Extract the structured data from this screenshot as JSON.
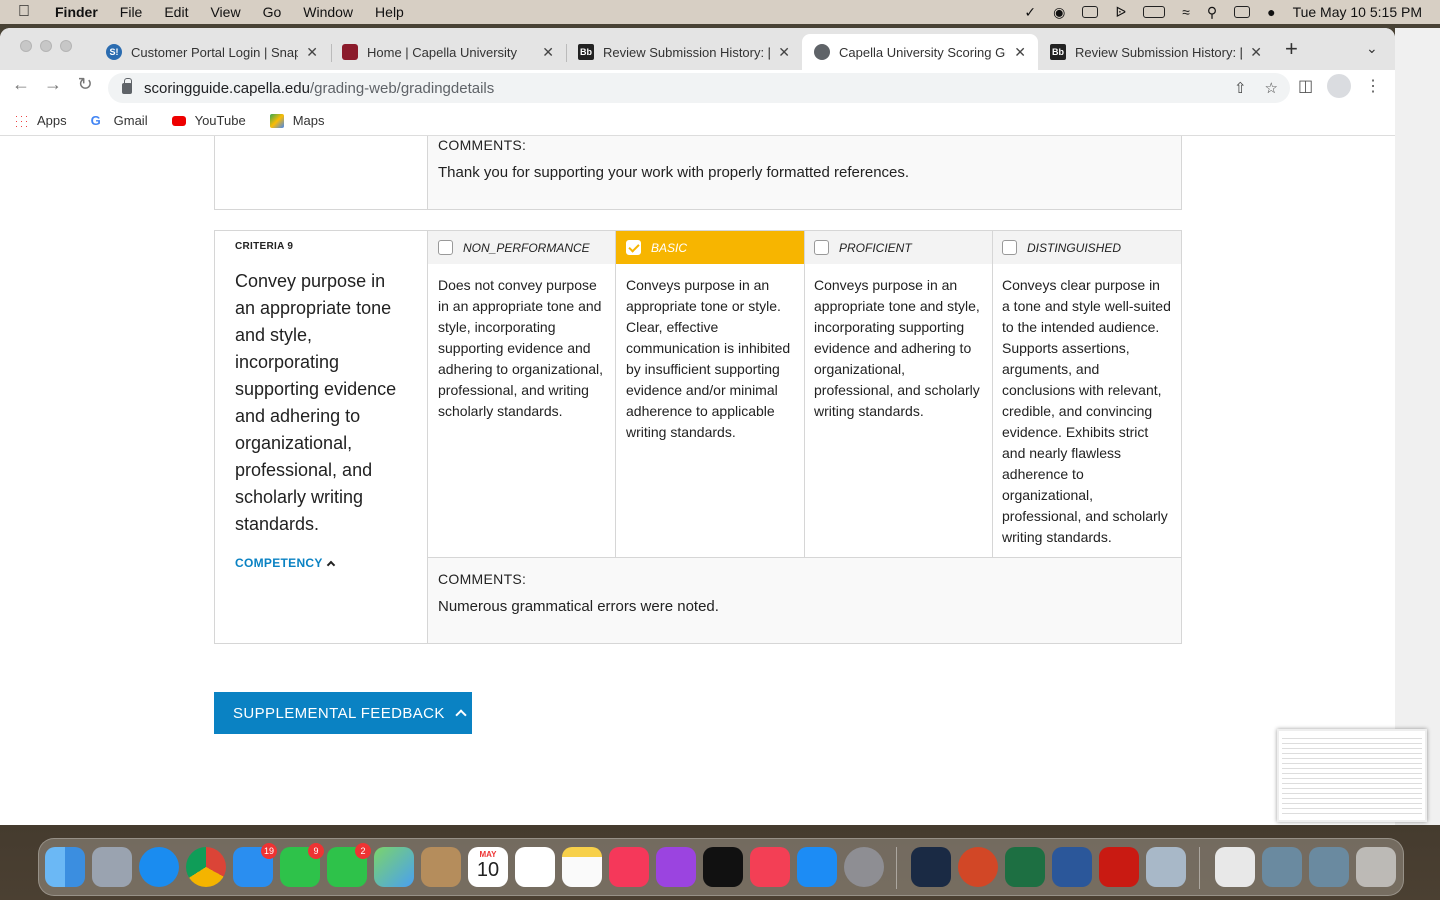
{
  "menubar": {
    "app": "Finder",
    "items": [
      "File",
      "Edit",
      "View",
      "Go",
      "Window",
      "Help"
    ],
    "clock": "Tue May 10  5:15 PM"
  },
  "browser": {
    "tabs": [
      {
        "title": "Customer Portal Login | Snap F",
        "favicon": "S!"
      },
      {
        "title": "Home | Capella University",
        "favicon": "shield"
      },
      {
        "title": "Review Submission History: [u",
        "favicon": "Bb"
      },
      {
        "title": "Capella University Scoring Gui",
        "favicon": "globe"
      },
      {
        "title": "Review Submission History: [u",
        "favicon": "Bb"
      }
    ],
    "url_host": "scoringguide.capella.edu",
    "url_path": "/grading-web/gradingdetails",
    "bookmarks": [
      "Apps",
      "Gmail",
      "YouTube",
      "Maps"
    ]
  },
  "prev_criterion": {
    "comments_label": "COMMENTS:",
    "comment": "Thank you for supporting your work with properly formatted references."
  },
  "criterion": {
    "title": "CRITERIA 9",
    "description": "Convey purpose in an appropriate tone and style, incorporating supporting evidence and adhering to organizational, professional, and scholarly writing standards.",
    "competency_label": "COMPETENCY",
    "levels": [
      {
        "name": "NON_PERFORMANCE",
        "selected": false,
        "text": "Does not convey purpose in an appropriate tone and style, incorporating supporting evidence and adhering to organizational, professional, and writing scholarly standards."
      },
      {
        "name": "BASIC",
        "selected": true,
        "text": "Conveys purpose in an appropriate tone or style. Clear, effective communication is inhibited by insufficient supporting evidence and/or minimal adherence to applicable writing standards."
      },
      {
        "name": "PROFICIENT",
        "selected": false,
        "text": "Conveys purpose in an appropriate tone and style, incorporating supporting evidence and adhering to organizational, professional, and scholarly writing standards."
      },
      {
        "name": "DISTINGUISHED",
        "selected": false,
        "text": "Conveys clear purpose in a tone and style well-suited to the intended audience. Supports assertions, arguments, and conclusions with relevant, credible, and convincing evidence. Exhibits strict and nearly flawless adherence to organizational, professional, and scholarly writing standards."
      }
    ],
    "comments_label": "COMMENTS:",
    "comment": "Numerous grammatical errors were noted."
  },
  "supplemental_feedback": "SUPPLEMENTAL FEEDBACK",
  "dock": {
    "mail_badge": "19",
    "facetime_badge": "9",
    "messages_badge": "2",
    "calendar_month": "MAY",
    "calendar_day": "10"
  },
  "colors": {
    "selected_level": "#f7b500",
    "accent_blue": "#0a82c3"
  }
}
